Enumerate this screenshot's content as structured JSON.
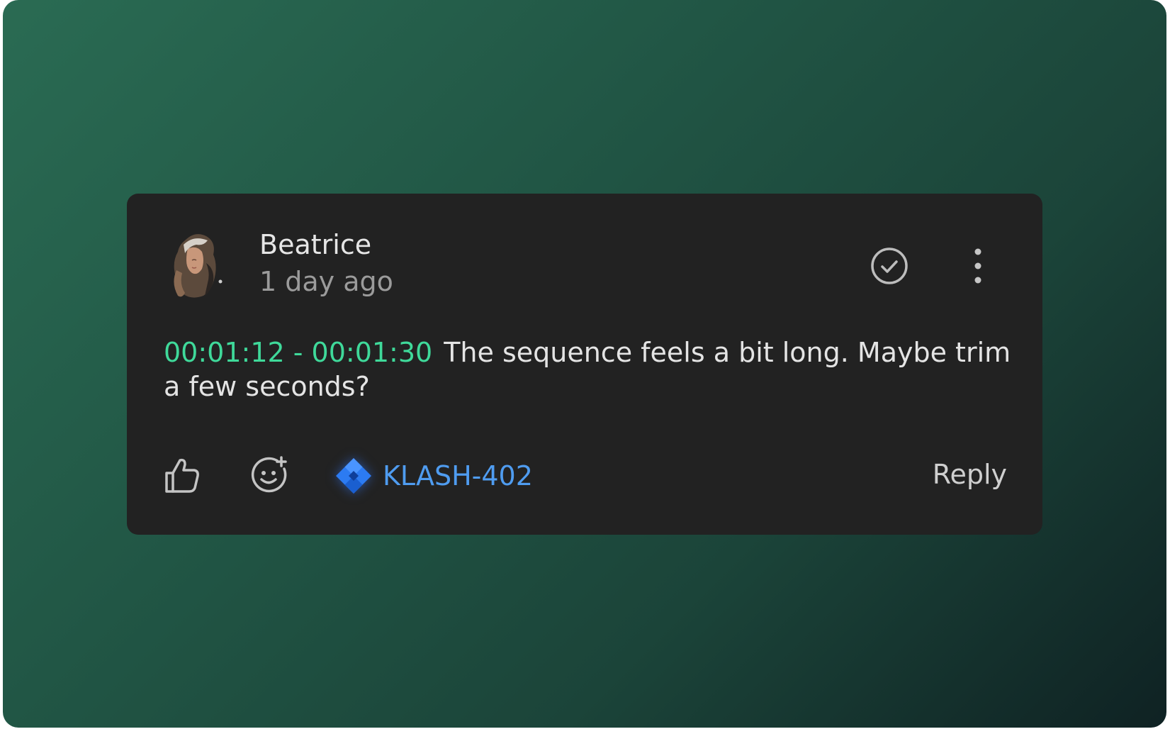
{
  "comment": {
    "author": "Beatrice",
    "timestamp": "1 day ago",
    "timecode": "00:01:12 - 00:01:30",
    "text": "The sequence feels a bit long. Maybe trim a few seconds?"
  },
  "actions": {
    "resolve_icon": "check-circle-icon",
    "more_icon": "vertical-ellipsis-icon",
    "like_icon": "thumbs-up-icon",
    "reaction_icon": "add-emoji-icon",
    "issue_icon": "jira-icon",
    "issue_key": "KLASH-402",
    "reply_label": "Reply"
  },
  "colors": {
    "timecode": "#3fd99a",
    "issue_link": "#4f9cf0",
    "card_background": "#222222"
  }
}
